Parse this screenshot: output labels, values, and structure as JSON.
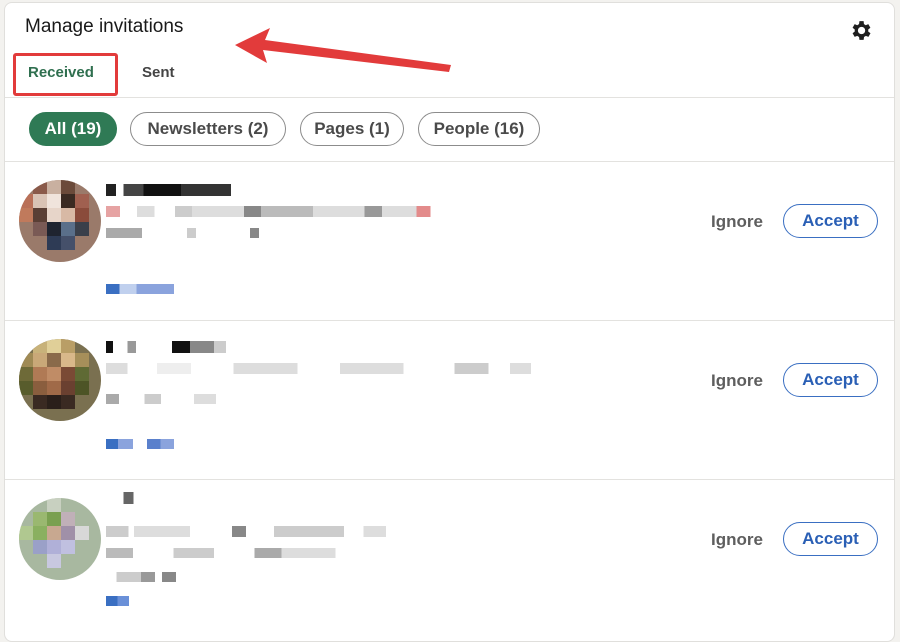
{
  "header": {
    "title": "Manage invitations",
    "settings_icon": "gear-icon"
  },
  "tabs": [
    {
      "label": "Received",
      "active": true
    },
    {
      "label": "Sent",
      "active": false
    }
  ],
  "filters": [
    {
      "label": "All (19)",
      "active": true
    },
    {
      "label": "Newsletters (2)",
      "active": false
    },
    {
      "label": "Pages (1)",
      "active": false
    },
    {
      "label": "People (16)",
      "active": false
    }
  ],
  "invitations": [
    {
      "ignore_label": "Ignore",
      "accept_label": "Accept"
    },
    {
      "ignore_label": "Ignore",
      "accept_label": "Accept"
    },
    {
      "ignore_label": "Ignore",
      "accept_label": "Accept"
    }
  ],
  "colors": {
    "accent_green": "#2f7a55",
    "accent_blue": "#2a5fb5",
    "annotation_red": "#e23b3b"
  }
}
